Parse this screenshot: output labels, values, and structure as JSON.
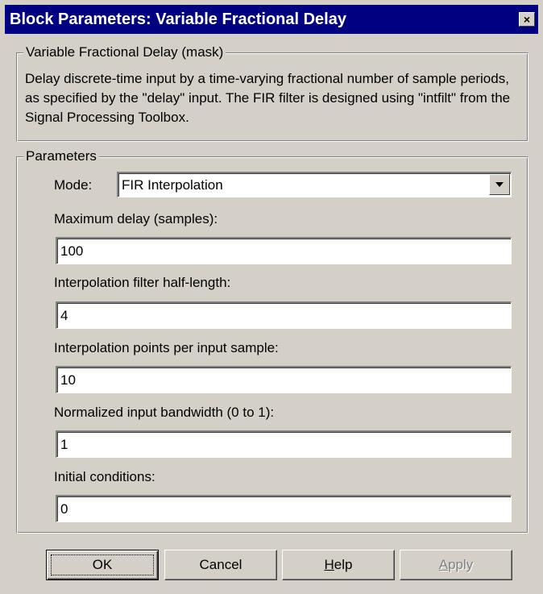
{
  "window": {
    "title": "Block Parameters: Variable Fractional Delay",
    "close_glyph": "×",
    "colors": {
      "face": "#d4d0c8",
      "titlebar": "#000080",
      "title_text": "#ffffff",
      "field_bg": "#ffffff",
      "disabled_text": "#808080"
    }
  },
  "description_group": {
    "legend": "Variable Fractional Delay (mask)",
    "text": "Delay discrete-time input by a time-varying fractional number of sample periods, as specified by the \"delay\" input.  The FIR filter is designed using \"intfilt\" from the Signal Processing Toolbox."
  },
  "parameters_group": {
    "legend": "Parameters",
    "mode": {
      "label": "Mode:",
      "value": "FIR Interpolation"
    },
    "fields": [
      {
        "label": "Maximum delay (samples):",
        "value": "100"
      },
      {
        "label": "Interpolation filter half-length:",
        "value": "4"
      },
      {
        "label": "Interpolation points per input sample:",
        "value": "10"
      },
      {
        "label": "Normalized input bandwidth (0 to 1):",
        "value": "1"
      },
      {
        "label": "Initial conditions:",
        "value": "0"
      }
    ]
  },
  "buttons": {
    "ok": {
      "label": "OK",
      "mnemonic": ""
    },
    "cancel": {
      "label": "Cancel"
    },
    "help": {
      "label": "Help",
      "mnemonic": "H",
      "rest": "elp"
    },
    "apply": {
      "label": "Apply",
      "mnemonic": "A",
      "rest": "pply",
      "disabled": true
    }
  }
}
